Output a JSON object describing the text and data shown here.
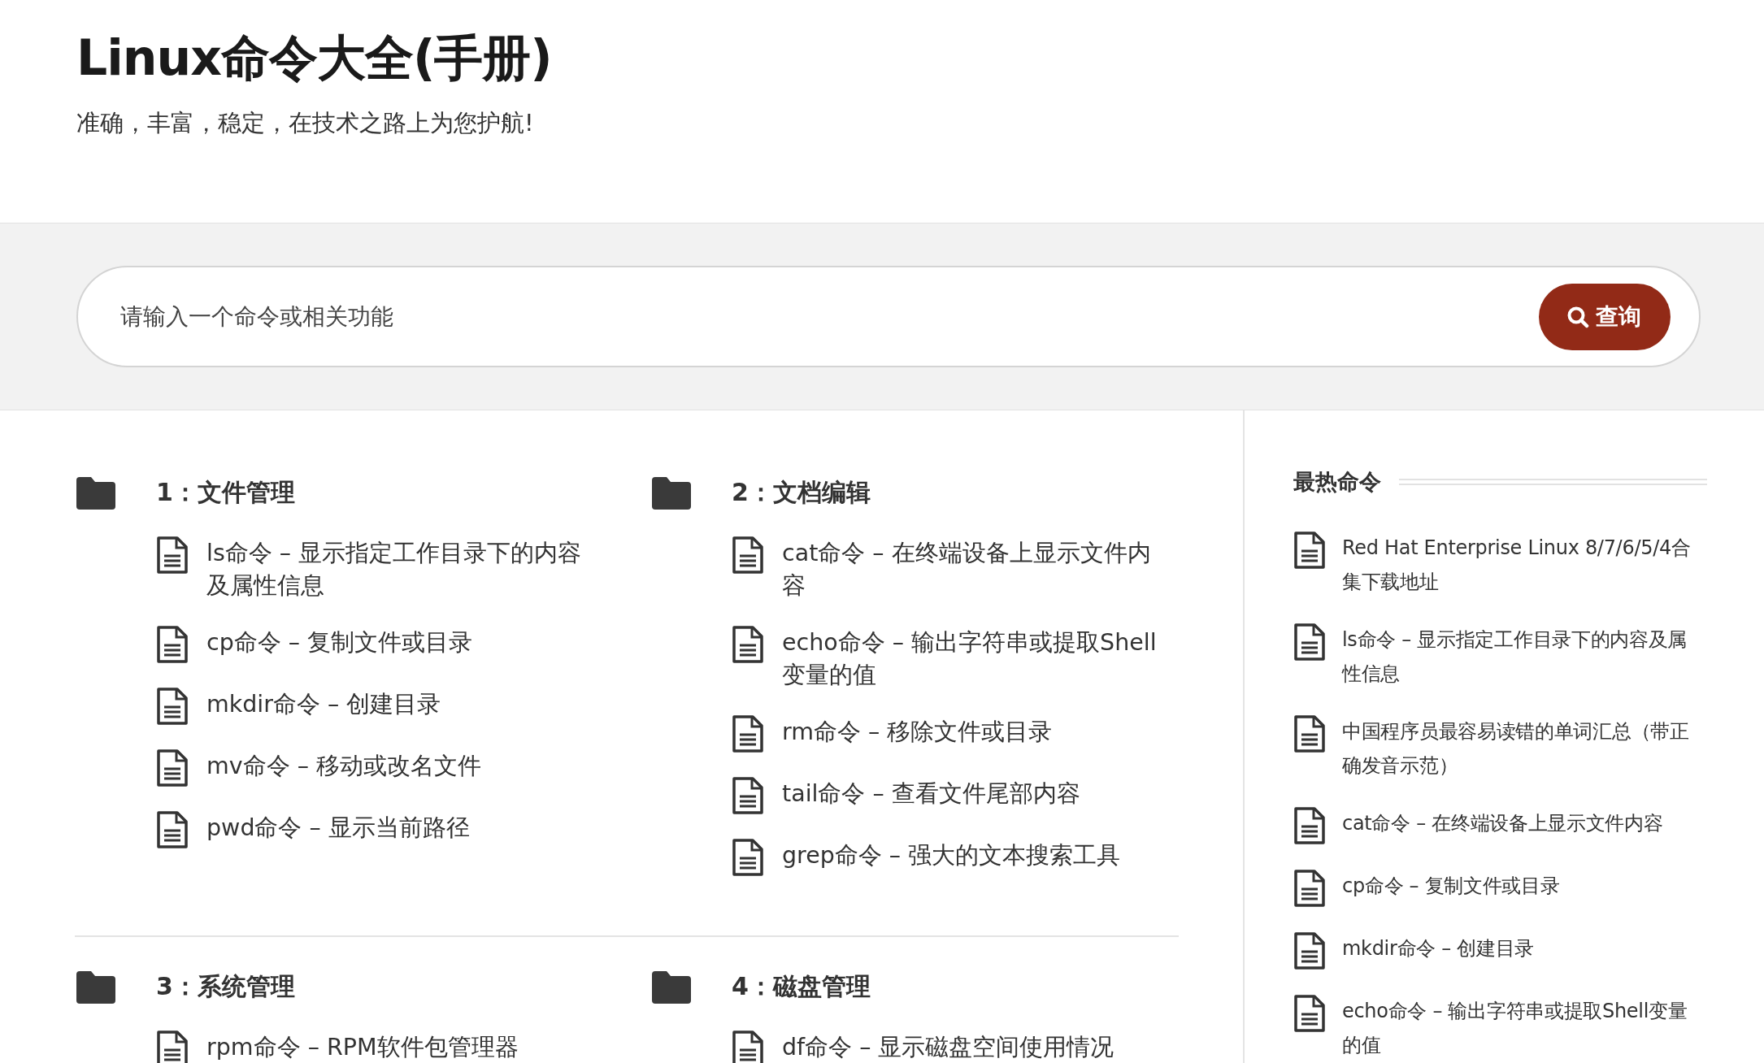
{
  "site": {
    "title": "Linux命令大全(手册)",
    "subtitle": "准确，丰富，稳定，在技术之路上为您护航!"
  },
  "search": {
    "placeholder": "请输入一个命令或相关功能",
    "button": "查询"
  },
  "categories": [
    {
      "title": "1：文件管理",
      "items": [
        "ls命令 – 显示指定工作目录下的内容及属性信息",
        "cp命令 – 复制文件或目录",
        "mkdir命令 – 创建目录",
        "mv命令 – 移动或改名文件",
        "pwd命令 – 显示当前路径"
      ]
    },
    {
      "title": "2：文档编辑",
      "items": [
        "cat命令 – 在终端设备上显示文件内容",
        "echo命令 – 输出字符串或提取Shell变量的值",
        "rm命令 – 移除文件或目录",
        "tail命令 – 查看文件尾部内容",
        "grep命令 – 强大的文本搜索工具"
      ]
    },
    {
      "title": "3：系统管理",
      "items": [
        "rpm命令 – RPM软件包管理器"
      ]
    },
    {
      "title": "4：磁盘管理",
      "items": [
        "df命令 – 显示磁盘空间使用情况"
      ]
    }
  ],
  "sidebar": {
    "heading": "最热命令",
    "items": [
      "Red Hat Enterprise Linux 8/7/6/5/4合集下载地址",
      "ls命令 – 显示指定工作目录下的内容及属性信息",
      "中国程序员最容易读错的单词汇总（带正确发音示范）",
      "cat命令 – 在终端设备上显示文件内容",
      "cp命令 – 复制文件或目录",
      "mkdir命令 – 创建目录",
      "echo命令 – 输出字符串或提取Shell变量的值"
    ]
  }
}
